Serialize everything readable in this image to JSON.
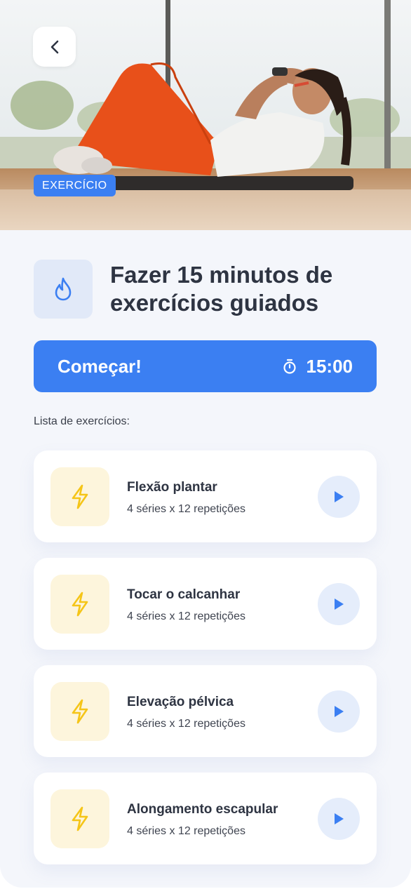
{
  "hero": {
    "tag": "EXERCÍCIO"
  },
  "activity": {
    "title_line1": "Fazer 15 minutos de",
    "title_line2": "exercícios guiados",
    "icon": "flame-icon"
  },
  "start": {
    "label": "Começar!",
    "duration": "15:00",
    "icon": "stopwatch-icon"
  },
  "list": {
    "heading": "Lista de exercícios:",
    "items": [
      {
        "name": "Flexão plantar",
        "detail": "4 séries x 12 repetições"
      },
      {
        "name": "Tocar o calcanhar",
        "detail": "4 séries x 12 repetições"
      },
      {
        "name": "Elevação pélvica",
        "detail": "4 séries x 12 repetições"
      },
      {
        "name": "Alongamento escapular",
        "detail": "4 séries x 12 repetições"
      }
    ]
  },
  "colors": {
    "accent": "#3b7ff2",
    "background": "#f4f6fb",
    "bolt": "#f5c518",
    "bolt_bg": "#fdf5dc",
    "play_bg": "#e5edfb"
  }
}
